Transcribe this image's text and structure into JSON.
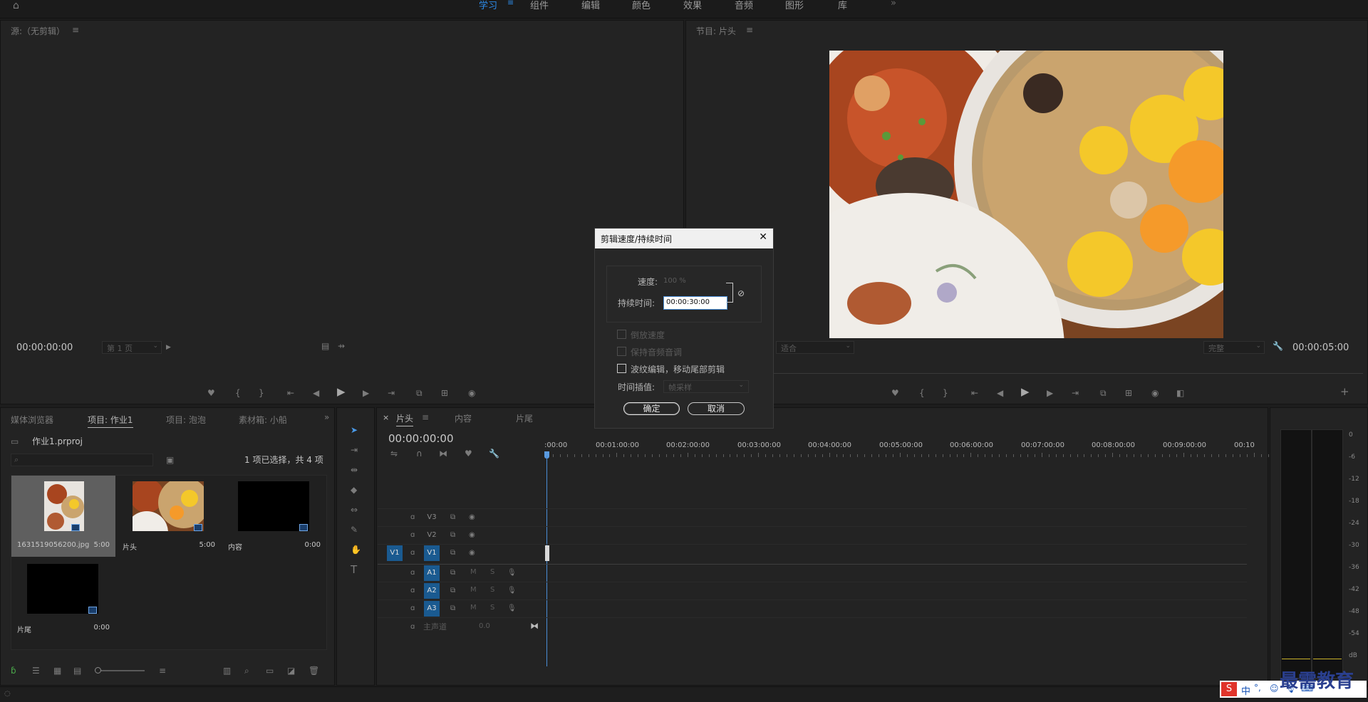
{
  "workspaces": {
    "learn": "学习",
    "assembly": "组件",
    "editing": "编辑",
    "color": "颜色",
    "effects": "效果",
    "audio": "音频",
    "graphics": "图形",
    "libraries": "库",
    "more": "»"
  },
  "source": {
    "title": "源:（无剪辑）",
    "menu": "≡",
    "timecode": "00:00:00:00",
    "page_select": "第 1 页"
  },
  "program": {
    "title": "节目: 片头",
    "menu": "≡",
    "fit_select": "适合",
    "quality_select": "完整",
    "timecode": "00:00:05:00"
  },
  "project": {
    "tabs": [
      "媒体浏览器",
      "项目: 作业1",
      "项目: 泡泡",
      "素材箱: 小船"
    ],
    "more": "»",
    "file": "作业1.prproj",
    "selection_info": "1 项已选择，共 4 项",
    "items": [
      {
        "name": "1631519056200.jpg",
        "duration": "5:00"
      },
      {
        "name": "片头",
        "duration": "5:00"
      },
      {
        "name": "内容",
        "duration": "0:00"
      },
      {
        "name": "片尾",
        "duration": "0:00"
      }
    ]
  },
  "timeline": {
    "tabs": [
      "片头",
      "内容",
      "片尾"
    ],
    "close": "×",
    "menu": "≡",
    "timecode": "00:00:00:00",
    "ruler": [
      ":00:00",
      "00:01:00:00",
      "00:02:00:00",
      "00:03:00:00",
      "00:04:00:00",
      "00:05:00:00",
      "00:06:00:00",
      "00:07:00:00",
      "00:08:00:00",
      "00:09:00:00",
      "00:10"
    ],
    "source_patch": "V1",
    "video_tracks": [
      "V3",
      "V2",
      "V1"
    ],
    "audio_tracks": [
      "A1",
      "A2",
      "A3"
    ],
    "mute": "M",
    "solo": "S",
    "master": "主声道",
    "master_value": "0.0"
  },
  "dialog": {
    "title": "剪辑速度/持续时间",
    "close": "✕",
    "speed_label": "速度:",
    "speed_value": "100 %",
    "duration_label": "持续时间:",
    "duration_value": "00:00:30:00",
    "reverse": "倒放速度",
    "maintain_pitch": "保持音频音调",
    "ripple": "波纹编辑，移动尾部剪辑",
    "interp_label": "时间插值:",
    "interp_value": "帧采样",
    "ok": "确定",
    "cancel": "取消"
  },
  "meter": {
    "labels": [
      "0",
      "-6",
      "-12",
      "-18",
      "-24",
      "-30",
      "-36",
      "-42",
      "-48",
      "-54",
      "dB"
    ]
  },
  "watermark": "最需教育",
  "taskbar": {
    "ime": "中",
    "punct": "°,"
  },
  "colors": {
    "accent": "#2d8ceb",
    "track_blue": "#1a5a90",
    "panel": "#232323",
    "dialog": "#272727"
  }
}
